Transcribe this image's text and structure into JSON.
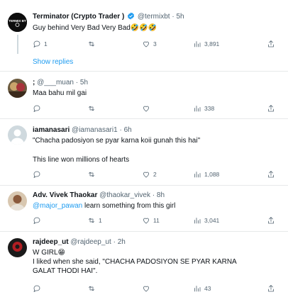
{
  "tweets": [
    {
      "name": "Terminator (Crypto Trader )",
      "handle": "@termixbt",
      "sep": "·",
      "time": "5h",
      "text_parts": [
        "Guy behind Very Bad Very Bad",
        "🤣🤣🤣"
      ],
      "replies": "1",
      "retweets": "",
      "likes": "3",
      "views": "3,891",
      "verified": true,
      "avatar_label": "TERMIX BT"
    },
    {
      "name": ";",
      "handle": "@___muan",
      "sep": "·",
      "time": "5h",
      "text": "Maa bahu mil gai",
      "replies": "",
      "retweets": "",
      "likes": "",
      "views": "338"
    },
    {
      "name": "iamanasari",
      "handle": "@iamanasari1",
      "sep": "·",
      "time": "6h",
      "text": "\"Chacha padosiyon se pyar karna koii gunah this hai\"",
      "text2": "This line won millions of hearts",
      "replies": "",
      "retweets": "",
      "likes": "2",
      "views": "1,088"
    },
    {
      "name": "Adv. Vivek Thaokar",
      "handle": "@thaokar_vivek",
      "sep": "·",
      "time": "8h",
      "mention": "@major_pawan",
      "text": " learn something from this girl",
      "replies": "",
      "retweets": "1",
      "likes": "11",
      "views": "3,041"
    },
    {
      "name": "rajdeep_ut",
      "handle": "@rajdeep_ut",
      "sep": "·",
      "time": "2h",
      "text": "W GIRL😁",
      "text2": "I liked when she said, \"CHACHA PADOSIYON SE PYAR KARNA GALAT THODI HAI\".",
      "replies": "",
      "retweets": "",
      "likes": "",
      "views": "43"
    }
  ],
  "show_replies_label": "Show replies",
  "icons": {
    "reply": "reply-icon",
    "retweet": "retweet-icon",
    "like": "heart-icon",
    "views": "views-icon",
    "share": "share-icon",
    "verified": "verified-badge-icon"
  },
  "colors": {
    "accent": "#1d9bf0",
    "muted": "#536471",
    "divider": "#e7e9ea"
  }
}
